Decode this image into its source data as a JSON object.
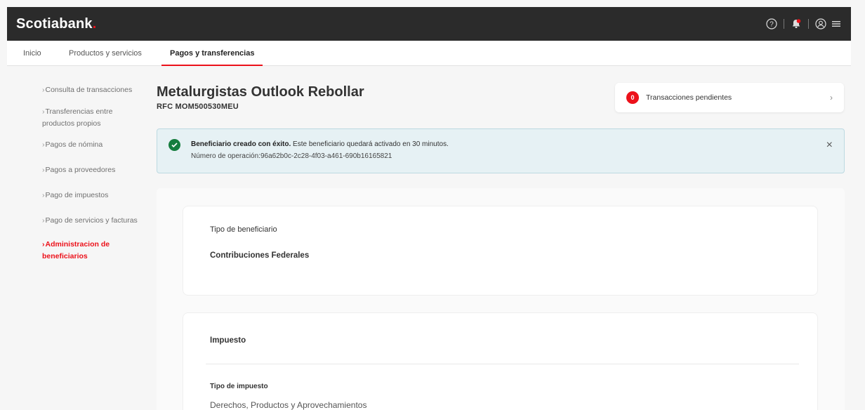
{
  "header": {
    "logo_text": "Scotiabank",
    "logo_dot": ".",
    "icons": [
      "help-icon",
      "notification-icon",
      "user-icon",
      "menu-icon"
    ]
  },
  "nav": {
    "items": [
      {
        "label": "Inicio"
      },
      {
        "label": "Productos y servicios"
      },
      {
        "label": "Pagos y transferencias"
      }
    ]
  },
  "sidebar": {
    "items": [
      {
        "label": "Consulta de transacciones"
      },
      {
        "label": "Transferencias entre productos propios"
      },
      {
        "label": "Pagos de nómina"
      },
      {
        "label": "Pagos a proveedores"
      },
      {
        "label": "Pago de impuestos"
      },
      {
        "label": "Pago de servicios y facturas"
      },
      {
        "label": "Administracion de beneficiarios"
      }
    ]
  },
  "page": {
    "title": "Metalurgistas Outlook Rebollar",
    "rfc": "RFC MOM500530MEU"
  },
  "pending": {
    "count": "0",
    "label": "Transacciones pendientes"
  },
  "alert": {
    "bold": "Beneficiario creado con éxito.",
    "message": " Este beneficiario quedará activado en 30 minutos.",
    "operation": "Número de operación:96a62b0c-2c28-4f03-a461-690b16165821"
  },
  "beneficiary": {
    "type_label": "Tipo de beneficiario",
    "type_value": "Contribuciones Federales"
  },
  "tax": {
    "section_label": "Impuesto",
    "type_label": "Tipo de impuesto",
    "type_value": "Derechos, Productos y Aprovechamientos"
  },
  "colors": {
    "brand_red": "#ec111a",
    "topbar": "#2b2b2b",
    "success_green": "#167d3e",
    "alert_bg": "#e6f1f4"
  }
}
